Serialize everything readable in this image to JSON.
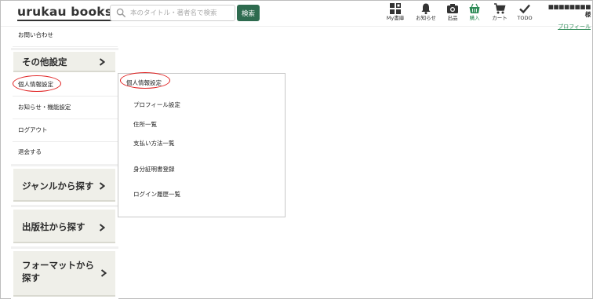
{
  "header": {
    "logo": "urukau books",
    "search": {
      "placeholder": "本のタイトル・著者名で検索",
      "button_label": "検索"
    },
    "nav": [
      {
        "label": "My書庫",
        "icon": "bookshelf-icon"
      },
      {
        "label": "お知らせ",
        "icon": "bell-icon"
      },
      {
        "label": "出品",
        "icon": "camera-icon"
      },
      {
        "label": "購入",
        "icon": "basket-icon",
        "active": true
      },
      {
        "label": "カート",
        "icon": "cart-icon"
      },
      {
        "label": "TODO",
        "icon": "checkmark-icon"
      }
    ],
    "user": {
      "name": "■■■■■■■■様",
      "profile_label": "プロフィール"
    },
    "accent_color": "#2e6b4f"
  },
  "sidebar": {
    "contact": "お問い合わせ",
    "other_settings": {
      "title": "その他設定",
      "items": [
        "個人情報設定",
        "お知らせ・機能設定",
        "ログアウト",
        "退会する"
      ]
    },
    "sections": [
      "ジャンルから探す",
      "出版社から探す",
      "フォーマットから探す"
    ]
  },
  "submenu": {
    "title": "個人情報設定",
    "items": [
      "プロフィール設定",
      "住所一覧",
      "支払い方法一覧",
      "身分証明書登録",
      "ログイン履歴一覧"
    ]
  }
}
